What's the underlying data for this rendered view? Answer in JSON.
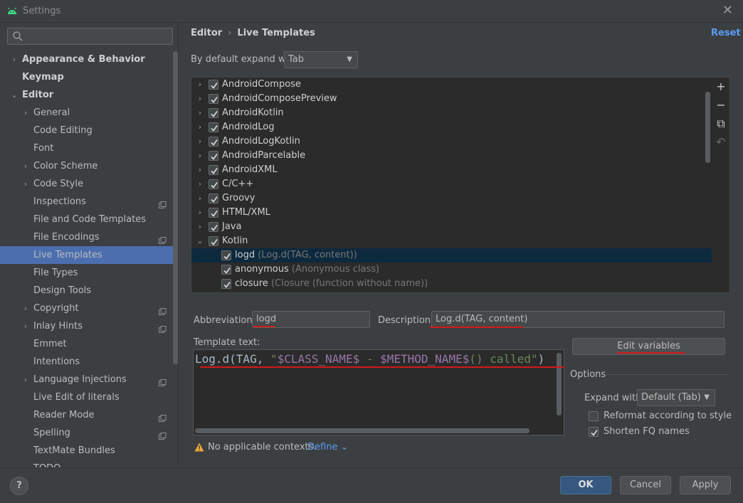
{
  "window": {
    "title": "Settings",
    "close_glyph": "✕"
  },
  "search": {
    "placeholder": ""
  },
  "tree": [
    {
      "label": "Appearance & Behavior",
      "level": 0,
      "arrow": "›",
      "bold": true,
      "copy": false,
      "selected": false
    },
    {
      "label": "Keymap",
      "level": 0,
      "arrow": "",
      "bold": true,
      "copy": false,
      "selected": false
    },
    {
      "label": "Editor",
      "level": 0,
      "arrow": "⌄",
      "bold": true,
      "copy": false,
      "selected": false
    },
    {
      "label": "General",
      "level": 1,
      "arrow": "›",
      "bold": false,
      "copy": false,
      "selected": false
    },
    {
      "label": "Code Editing",
      "level": 1,
      "arrow": "",
      "bold": false,
      "copy": false,
      "selected": false
    },
    {
      "label": "Font",
      "level": 1,
      "arrow": "",
      "bold": false,
      "copy": false,
      "selected": false
    },
    {
      "label": "Color Scheme",
      "level": 1,
      "arrow": "›",
      "bold": false,
      "copy": false,
      "selected": false
    },
    {
      "label": "Code Style",
      "level": 1,
      "arrow": "›",
      "bold": false,
      "copy": false,
      "selected": false
    },
    {
      "label": "Inspections",
      "level": 1,
      "arrow": "",
      "bold": false,
      "copy": true,
      "selected": false
    },
    {
      "label": "File and Code Templates",
      "level": 1,
      "arrow": "",
      "bold": false,
      "copy": false,
      "selected": false
    },
    {
      "label": "File Encodings",
      "level": 1,
      "arrow": "",
      "bold": false,
      "copy": true,
      "selected": false
    },
    {
      "label": "Live Templates",
      "level": 1,
      "arrow": "",
      "bold": false,
      "copy": false,
      "selected": true
    },
    {
      "label": "File Types",
      "level": 1,
      "arrow": "",
      "bold": false,
      "copy": false,
      "selected": false
    },
    {
      "label": "Design Tools",
      "level": 1,
      "arrow": "",
      "bold": false,
      "copy": false,
      "selected": false
    },
    {
      "label": "Copyright",
      "level": 1,
      "arrow": "›",
      "bold": false,
      "copy": true,
      "selected": false
    },
    {
      "label": "Inlay Hints",
      "level": 1,
      "arrow": "›",
      "bold": false,
      "copy": true,
      "selected": false
    },
    {
      "label": "Emmet",
      "level": 1,
      "arrow": "",
      "bold": false,
      "copy": false,
      "selected": false
    },
    {
      "label": "Intentions",
      "level": 1,
      "arrow": "",
      "bold": false,
      "copy": false,
      "selected": false
    },
    {
      "label": "Language Injections",
      "level": 1,
      "arrow": "›",
      "bold": false,
      "copy": true,
      "selected": false
    },
    {
      "label": "Live Edit of literals",
      "level": 1,
      "arrow": "",
      "bold": false,
      "copy": false,
      "selected": false
    },
    {
      "label": "Reader Mode",
      "level": 1,
      "arrow": "",
      "bold": false,
      "copy": true,
      "selected": false
    },
    {
      "label": "Spelling",
      "level": 1,
      "arrow": "",
      "bold": false,
      "copy": true,
      "selected": false
    },
    {
      "label": "TextMate Bundles",
      "level": 1,
      "arrow": "",
      "bold": false,
      "copy": false,
      "selected": false
    },
    {
      "label": "TODO",
      "level": 1,
      "arrow": "",
      "bold": false,
      "copy": false,
      "selected": false
    }
  ],
  "breadcrumb": {
    "parent": "Editor",
    "separator": "›",
    "current": "Live Templates"
  },
  "reset_label": "Reset",
  "expand_with": {
    "label": "By default expand with",
    "value": "Tab",
    "caret": "▼"
  },
  "templates": [
    {
      "name": "AndroidCompose",
      "desc": "",
      "group": true,
      "expanded": false,
      "checked": true,
      "selected": false
    },
    {
      "name": "AndroidComposePreview",
      "desc": "",
      "group": true,
      "expanded": false,
      "checked": true,
      "selected": false
    },
    {
      "name": "AndroidKotlin",
      "desc": "",
      "group": true,
      "expanded": false,
      "checked": true,
      "selected": false
    },
    {
      "name": "AndroidLog",
      "desc": "",
      "group": true,
      "expanded": false,
      "checked": true,
      "selected": false
    },
    {
      "name": "AndroidLogKotlin",
      "desc": "",
      "group": true,
      "expanded": false,
      "checked": true,
      "selected": false
    },
    {
      "name": "AndroidParcelable",
      "desc": "",
      "group": true,
      "expanded": false,
      "checked": true,
      "selected": false
    },
    {
      "name": "AndroidXML",
      "desc": "",
      "group": true,
      "expanded": false,
      "checked": true,
      "selected": false
    },
    {
      "name": "C/C++",
      "desc": "",
      "group": true,
      "expanded": false,
      "checked": true,
      "selected": false
    },
    {
      "name": "Groovy",
      "desc": "",
      "group": true,
      "expanded": false,
      "checked": true,
      "selected": false
    },
    {
      "name": "HTML/XML",
      "desc": "",
      "group": true,
      "expanded": false,
      "checked": true,
      "selected": false
    },
    {
      "name": "Java",
      "desc": "",
      "group": true,
      "expanded": false,
      "checked": true,
      "selected": false
    },
    {
      "name": "Kotlin",
      "desc": "",
      "group": true,
      "expanded": true,
      "checked": true,
      "selected": false
    },
    {
      "name": "logd",
      "desc": "(Log.d(TAG, content))",
      "group": false,
      "expanded": false,
      "checked": true,
      "selected": true
    },
    {
      "name": "anonymous",
      "desc": "(Anonymous class)",
      "group": false,
      "expanded": false,
      "checked": true,
      "selected": false
    },
    {
      "name": "closure",
      "desc": "(Closure (function without name))",
      "group": false,
      "expanded": false,
      "checked": true,
      "selected": false
    }
  ],
  "side_tools": {
    "add": "+",
    "remove": "−",
    "copy": "⧉",
    "restore": "↶"
  },
  "abbreviation": {
    "label": "Abbreviation:",
    "value": "logd"
  },
  "description": {
    "label": "Description:",
    "value": "Log.d(TAG, content)"
  },
  "template_text": {
    "label": "Template text:",
    "parts": [
      {
        "text": "Log.d(TAG, ",
        "kind": "plain"
      },
      {
        "text": "\"",
        "kind": "str"
      },
      {
        "text": "$CLASS_NAME$",
        "kind": "var"
      },
      {
        "text": " - ",
        "kind": "str"
      },
      {
        "text": "$METHOD_NAME$",
        "kind": "var"
      },
      {
        "text": "() called\"",
        "kind": "str"
      },
      {
        "text": ")",
        "kind": "plain"
      }
    ]
  },
  "edit_variables_label": "Edit variables",
  "options": {
    "label": "Options",
    "expand_with_label": "Expand with",
    "expand_with_value": "Default (Tab)",
    "reformat": {
      "label": "Reformat according to style",
      "checked": false
    },
    "shorten": {
      "label": "Shorten FQ names",
      "checked": true
    }
  },
  "warning": {
    "text": "No applicable contexts.",
    "define": "Define ⌄"
  },
  "footer": {
    "help": "?",
    "ok": "OK",
    "cancel": "Cancel",
    "apply": "Apply"
  },
  "colors": {
    "selection": "#4b6eaf",
    "link": "#589df6",
    "annotation_red": "#d11a1a",
    "android_green": "#3ddc84"
  }
}
